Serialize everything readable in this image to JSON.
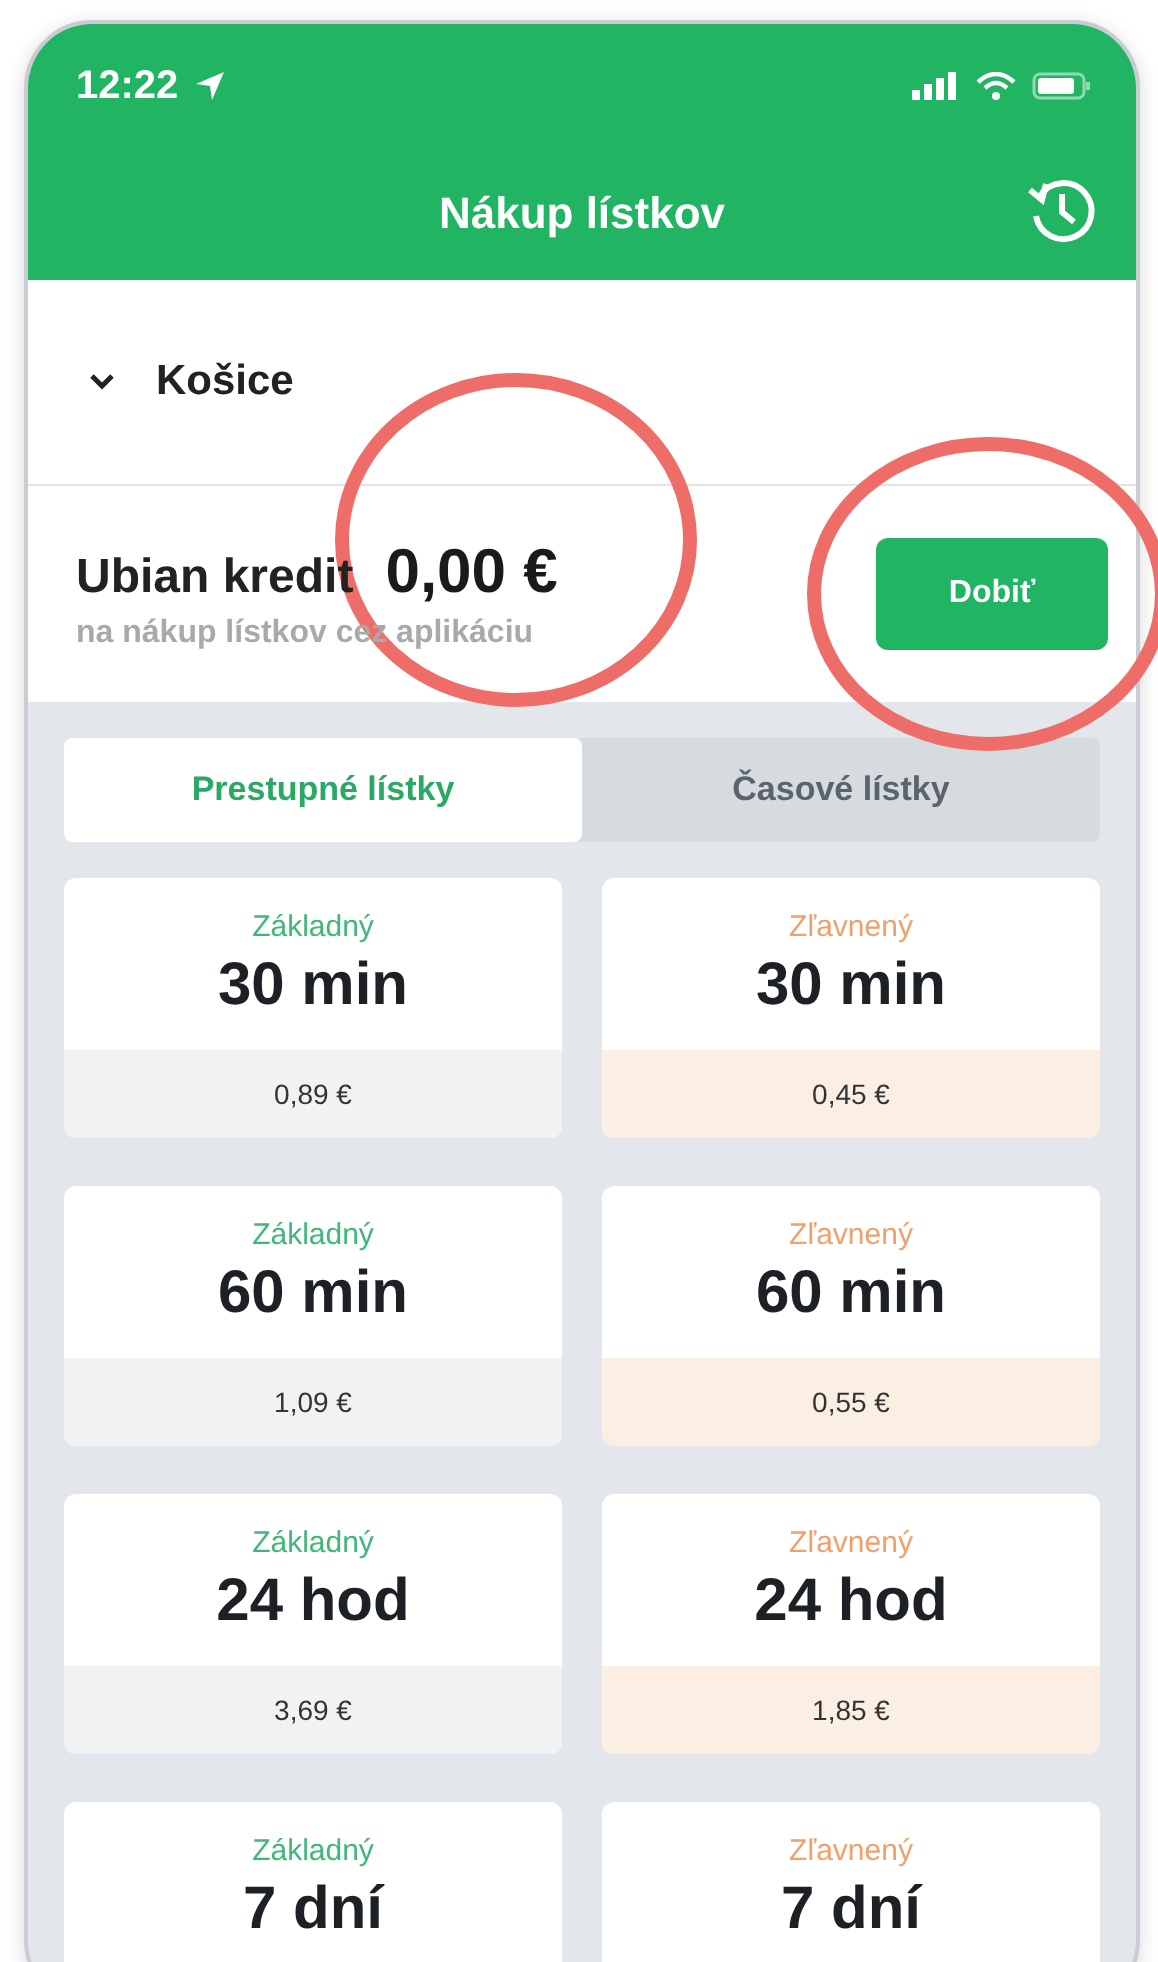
{
  "status_bar": {
    "time": "12:22"
  },
  "header": {
    "title": "Nákup lístkov"
  },
  "city": {
    "name": "Košice",
    "expanded": true
  },
  "credit": {
    "label": "Ubian kredit",
    "amount": "0,00 €",
    "note": "na nákup lístkov cez aplikáciu",
    "button": "Dobiť"
  },
  "tabs": [
    {
      "label": "Prestupné lístky",
      "selected": true
    },
    {
      "label": "Časové lístky",
      "selected": false
    }
  ],
  "tickets": [
    {
      "kind": "basic",
      "type": "Základný",
      "duration": "30 min",
      "price": "0,89 €"
    },
    {
      "kind": "discounted",
      "type": "Zľavnený",
      "duration": "30 min",
      "price": "0,45 €"
    },
    {
      "kind": "basic",
      "type": "Základný",
      "duration": "60 min",
      "price": "1,09 €"
    },
    {
      "kind": "discounted",
      "type": "Zľavnený",
      "duration": "60 min",
      "price": "0,55 €"
    },
    {
      "kind": "basic",
      "type": "Základný",
      "duration": "24 hod",
      "price": "3,69 €"
    },
    {
      "kind": "discounted",
      "type": "Zľavnený",
      "duration": "24 hod",
      "price": "1,85 €"
    },
    {
      "kind": "basic",
      "type": "Základný",
      "duration": "7 dní"
    },
    {
      "kind": "discounted",
      "type": "Zľavnený",
      "duration": "7 dní"
    }
  ]
}
